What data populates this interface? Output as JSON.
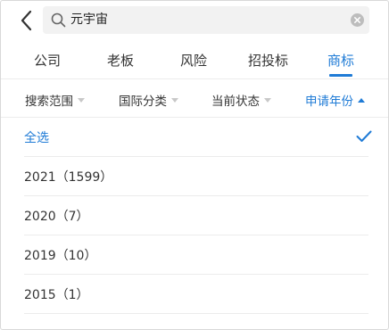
{
  "search": {
    "value": "元宇宙",
    "placeholder": ""
  },
  "tabs": [
    {
      "label": "公司",
      "active": false
    },
    {
      "label": "老板",
      "active": false
    },
    {
      "label": "风险",
      "active": false
    },
    {
      "label": "招投标",
      "active": false
    },
    {
      "label": "商标",
      "active": true
    }
  ],
  "filters": [
    {
      "label": "搜索范围",
      "active": false,
      "caret": "down"
    },
    {
      "label": "国际分类",
      "active": false,
      "caret": "down"
    },
    {
      "label": "当前状态",
      "active": false,
      "caret": "down"
    },
    {
      "label": "申请年份",
      "active": true,
      "caret": "up"
    }
  ],
  "options": [
    {
      "label": "全选",
      "selected": true
    },
    {
      "label": "2021（1599）",
      "selected": false
    },
    {
      "label": "2020（7）",
      "selected": false
    },
    {
      "label": "2019（10）",
      "selected": false
    },
    {
      "label": "2015（1）",
      "selected": false
    }
  ],
  "colors": {
    "accent": "#1f7bd6",
    "text": "#333333",
    "divider": "#ececec",
    "search_bg": "#f2f2f2"
  },
  "icons": {
    "back": "chevron-left-icon",
    "search": "search-icon",
    "clear": "clear-icon",
    "check": "check-icon"
  }
}
